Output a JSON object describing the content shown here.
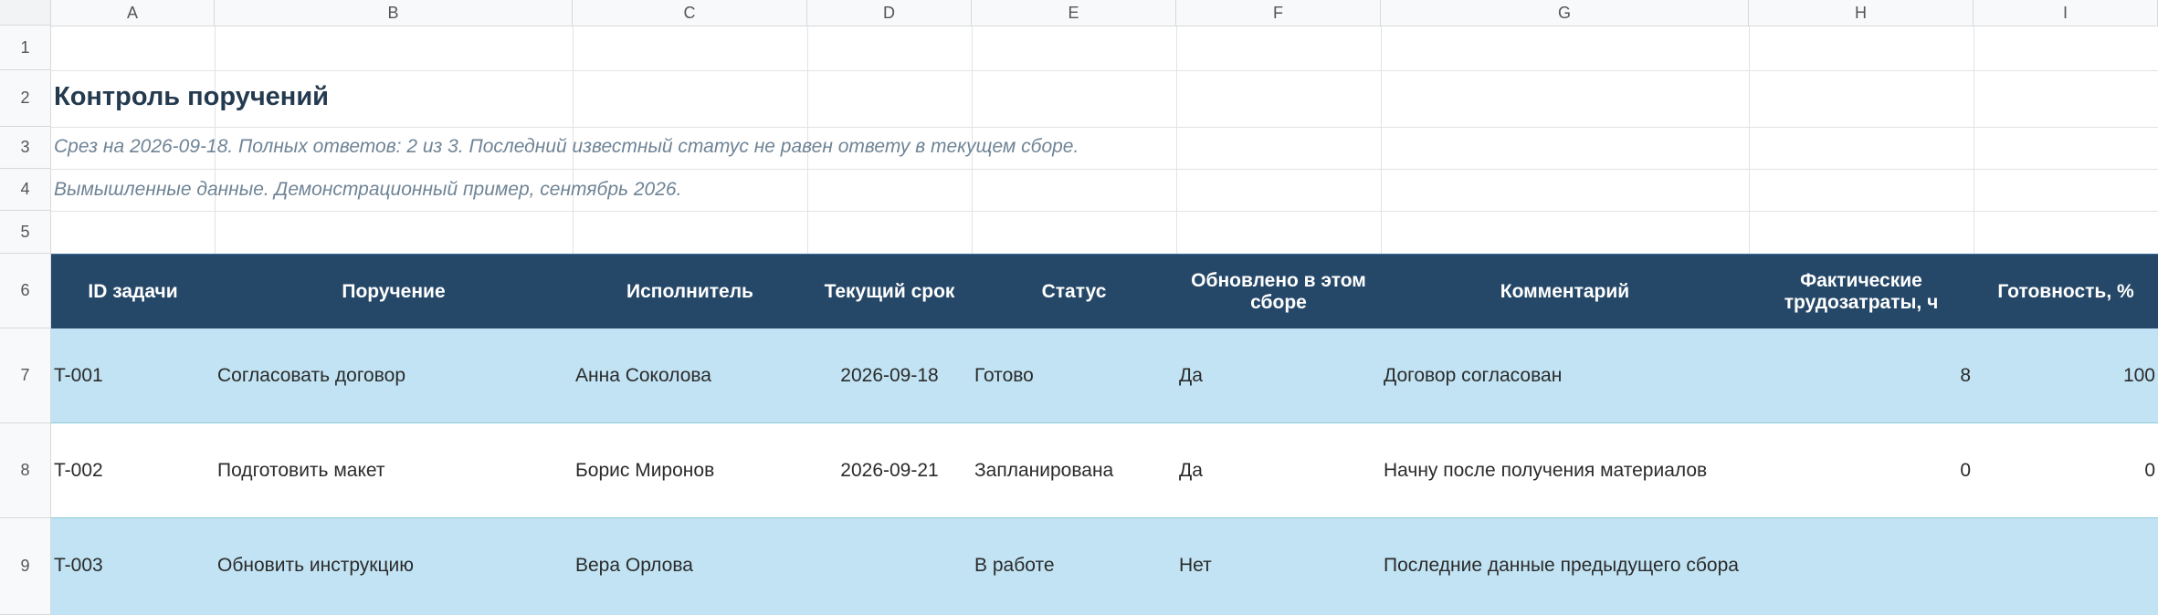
{
  "columns": [
    "A",
    "B",
    "C",
    "D",
    "E",
    "F",
    "G",
    "H",
    "I"
  ],
  "rows": [
    "1",
    "2",
    "3",
    "4",
    "5",
    "6",
    "7",
    "8",
    "9"
  ],
  "title": "Контроль поручений",
  "subtitle1": "Срез на 2026-09-18. Полных ответов: 2 из 3. Последний известный статус не равен ответу в текущем сборе.",
  "subtitle2": "Вымышленные данные. Демонстрационный пример, сентябрь 2026.",
  "table": {
    "headers": [
      "ID задачи",
      "Поручение",
      "Исполнитель",
      "Текущий срок",
      "Статус",
      "Обновлено в этом сборе",
      "Комментарий",
      "Фактические трудозатраты, ч",
      "Готовность, %"
    ],
    "rows": [
      [
        "T-001",
        "Согласовать договор",
        "Анна Соколова",
        "2026-09-18",
        "Готово",
        "Да",
        "Договор согласован",
        "8",
        "100"
      ],
      [
        "T-002",
        "Подготовить макет",
        "Борис Миронов",
        "2026-09-21",
        "Запланирована",
        "Да",
        "Начну после получения материалов",
        "0",
        "0"
      ],
      [
        "T-003",
        "Обновить инструкцию",
        "Вера Орлова",
        "",
        "В работе",
        "Нет",
        "Последние данные предыдущего сбора",
        "",
        ""
      ]
    ]
  },
  "colors": {
    "header_bg": "#264868",
    "row_shaded": "#c1e3f3",
    "title": "#243a4f",
    "subtitle": "#6f8496"
  }
}
